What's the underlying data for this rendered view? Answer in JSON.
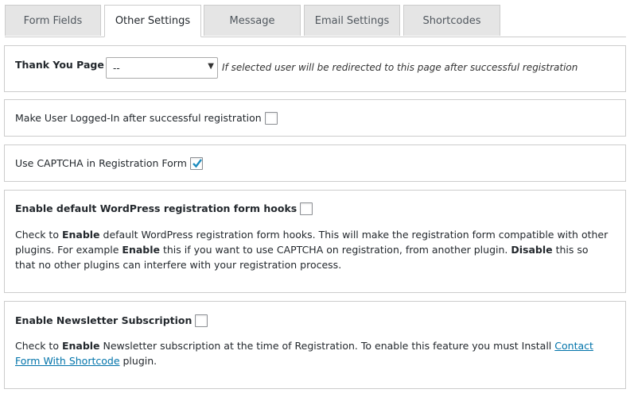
{
  "tabs": [
    {
      "label": "Form Fields",
      "active": false
    },
    {
      "label": "Other Settings",
      "active": true
    },
    {
      "label": "Message",
      "active": false
    },
    {
      "label": "Email Settings",
      "active": false
    },
    {
      "label": "Shortcodes",
      "active": false
    }
  ],
  "thank_you": {
    "label": "Thank You Page",
    "select_value": "--",
    "hint": "If selected user will be redirected to this page after successful registration"
  },
  "logged_in": {
    "label": "Make User Logged-In after successful registration",
    "checked": false
  },
  "captcha": {
    "label": "Use CAPTCHA in Registration Form",
    "checked": true
  },
  "hooks": {
    "label": "Enable default WordPress registration form hooks",
    "checked": false,
    "desc": {
      "p1": "Check to ",
      "b1": "Enable",
      "p2": " default WordPress registration form hooks. This will make the registration form compatible with other plugins. For example ",
      "b2": "Enable",
      "p3": " this if you want to use CAPTCHA on registration, from another plugin. ",
      "b3": "Disable",
      "p4": " this so that no other plugins can interfere with your registration process."
    }
  },
  "newsletter": {
    "label": "Enable Newsletter Subscription",
    "checked": false,
    "desc": {
      "p1": "Check to ",
      "b1": "Enable",
      "p2": " Newsletter subscription at the time of Registration. To enable this feature you must Install ",
      "link": "Contact Form With Shortcode",
      "p3": " plugin."
    }
  },
  "colors": {
    "accent": "#0073aa",
    "check": "#1e8cbe",
    "border": "#cccccc",
    "tab_bg": "#e5e5e5"
  }
}
